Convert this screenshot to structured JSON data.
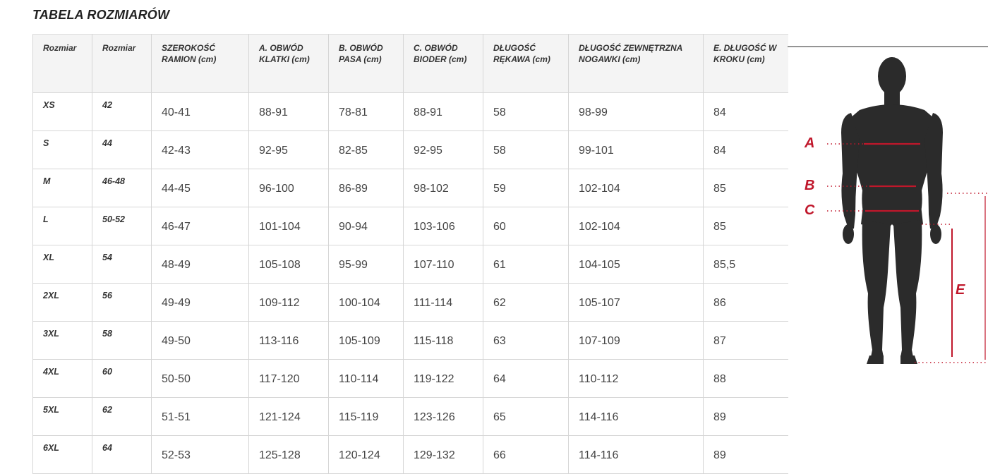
{
  "title": "TABELA ROZMIARÓW",
  "table": {
    "headers": [
      "Rozmiar",
      "Rozmiar",
      "SZEROKOŚĆ RAMION (cm)",
      "A. OBWÓD KLATKI (cm)",
      "B. OBWÓD PASA (cm)",
      "C. OBWÓD BIODER (cm)",
      "DŁUGOŚĆ RĘKAWA (cm)",
      "DŁUGOŚĆ ZEWNĘTRZNA NOGAWKI (cm)",
      "E. DŁUGOŚĆ W KROKU (cm)"
    ],
    "rows": [
      [
        "XS",
        "42",
        "40-41",
        "88-91",
        "78-81",
        "88-91",
        "58",
        "98-99",
        "84"
      ],
      [
        "S",
        "44",
        "42-43",
        "92-95",
        "82-85",
        "92-95",
        "58",
        "99-101",
        "84"
      ],
      [
        "M",
        "46-48",
        "44-45",
        "96-100",
        "86-89",
        "98-102",
        "59",
        "102-104",
        "85"
      ],
      [
        "L",
        "50-52",
        "46-47",
        "101-104",
        "90-94",
        "103-106",
        "60",
        "102-104",
        "85"
      ],
      [
        "XL",
        "54",
        "48-49",
        "105-108",
        "95-99",
        "107-110",
        "61",
        "104-105",
        "85,5"
      ],
      [
        "2XL",
        "56",
        "49-49",
        "109-112",
        "100-104",
        "111-114",
        "62",
        "105-107",
        "86"
      ],
      [
        "3XL",
        "58",
        "49-50",
        "113-116",
        "105-109",
        "115-118",
        "63",
        "107-109",
        "87"
      ],
      [
        "4XL",
        "60",
        "50-50",
        "117-120",
        "110-114",
        "119-122",
        "64",
        "110-112",
        "88"
      ],
      [
        "5XL",
        "62",
        "51-51",
        "121-124",
        "115-119",
        "123-126",
        "65",
        "114-116",
        "89"
      ],
      [
        "6XL",
        "64",
        "52-53",
        "125-128",
        "120-124",
        "129-132",
        "66",
        "114-116",
        "89"
      ]
    ]
  },
  "figure": {
    "icon": "body-measurement-silhouette",
    "markers": {
      "a": "A",
      "b": "B",
      "c": "C",
      "e": "E"
    },
    "accent_color": "#c0172b",
    "silhouette_color": "#2b2b2b"
  }
}
